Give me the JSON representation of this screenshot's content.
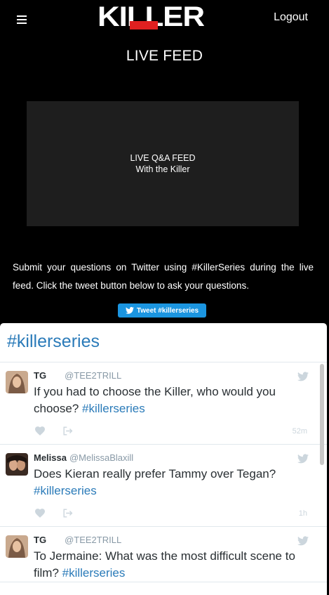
{
  "header": {
    "logo_text": "KILLER",
    "logout_label": "Logout",
    "menu_icon": "hamburger-icon"
  },
  "page_title": "LIVE FEED",
  "video": {
    "line1": "LIVE Q&A FEED",
    "line2": "With the Killer"
  },
  "instructions": "Submit your questions on Twitter using #KillerSeries during the live feed. Click the tweet button below to ask your questions.",
  "tweet_button_label": "Tweet #killerseries",
  "timeline": {
    "title": "#killerseries",
    "tweets": [
      {
        "name": "TG",
        "handle": "@TEE2TRILL",
        "text": "If you had to choose the Killer, who would you choose?",
        "hashtag": "#killerseries",
        "time": "52m"
      },
      {
        "name": "Melissa",
        "handle": "@MelissaBlaxill",
        "text": "Does Kieran really prefer Tammy over Tegan?",
        "hashtag": "#killerseries",
        "time": "1h"
      },
      {
        "name": "TG",
        "handle": "@TEE2TRILL",
        "text": "To Jermaine: What was the most difficult scene to film?",
        "hashtag": "#killerseries",
        "time": ""
      }
    ]
  },
  "colors": {
    "background": "#000000",
    "twitter_blue": "#1b95e0",
    "link_blue": "#2b7bb9",
    "logo_red": "#e02020"
  }
}
